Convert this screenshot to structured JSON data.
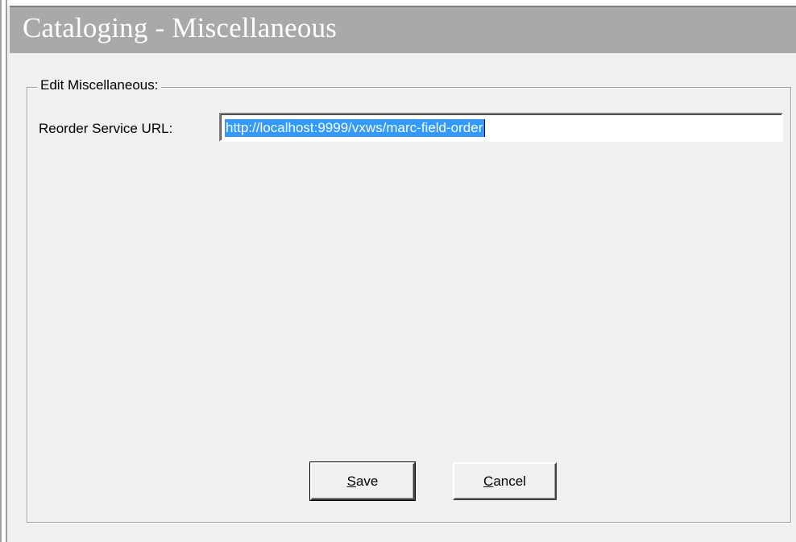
{
  "window": {
    "title": "Cataloging - Miscellaneous"
  },
  "group": {
    "legend": "Edit Miscellaneous:"
  },
  "fields": {
    "reorder_service_url": {
      "label": "Reorder Service URL:",
      "value": "http://localhost:9999/vxws/marc-field-order",
      "selected": true
    }
  },
  "buttons": {
    "save": {
      "mnemonic": "S",
      "rest": "ave",
      "label": "Save"
    },
    "cancel": {
      "mnemonic": "C",
      "rest": "ancel",
      "label": "Cancel"
    }
  },
  "colors": {
    "titlebar_background": "#a9a9a9",
    "title_text": "#ffffff",
    "selection_highlight": "#3399ff",
    "dialog_background": "#f0f0f0"
  }
}
